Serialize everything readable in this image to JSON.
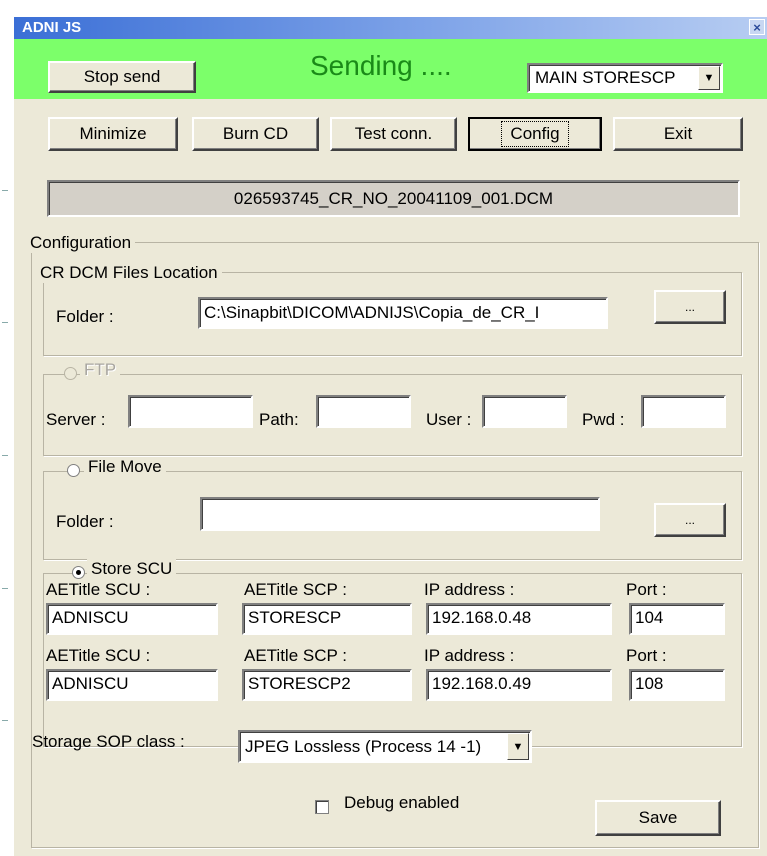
{
  "window": {
    "title": "ADNI JS",
    "close_glyph": "×"
  },
  "header": {
    "stop_send_label": "Stop send",
    "status_text": "Sending ....",
    "destination_selected": "MAIN STORESCP",
    "accent_color": "#7cff6a"
  },
  "toolbar": {
    "minimize_label": "Minimize",
    "burn_cd_label": "Burn CD",
    "test_conn_label": "Test conn.",
    "config_label": "Config",
    "exit_label": "Exit"
  },
  "current_file": "026593745_CR_NO_20041109_001.DCM",
  "configuration": {
    "legend": "Configuration",
    "cr_location": {
      "legend": "CR DCM Files Location",
      "folder_label": "Folder :",
      "folder_value": "C:\\Sinapbit\\DICOM\\ADNIJS\\Copia_de_CR_I",
      "browse_label": "..."
    },
    "ftp": {
      "legend": "FTP",
      "server_label": "Server :",
      "path_label": "Path:",
      "user_label": "User :",
      "pwd_label": "Pwd :"
    },
    "file_move": {
      "legend": "File Move",
      "folder_label": "Folder :",
      "folder_value": "",
      "browse_label": "..."
    },
    "store_scu": {
      "legend": "Store SCU",
      "rows": [
        {
          "aetitle_scu_label": "AETitle SCU :",
          "aetitle_scp_label": "AETitle SCP :",
          "ip_label": "IP address   :",
          "port_label": "Port   :",
          "aetitle_scu": "ADNISCU",
          "aetitle_scp": "STORESCP",
          "ip": "192.168.0.48",
          "port": "104"
        },
        {
          "aetitle_scu_label": "AETitle SCU :",
          "aetitle_scp_label": "AETitle SCP :",
          "ip_label": "IP address   :",
          "port_label": "Port   :",
          "aetitle_scu": "ADNISCU",
          "aetitle_scp": "STORESCP2",
          "ip": "192.168.0.49",
          "port": "108"
        }
      ]
    },
    "sop_class_label": "Storage SOP class :",
    "sop_class_value": "JPEG Lossless (Process 14 -1)",
    "debug_label": "Debug enabled",
    "save_label": "Save"
  }
}
